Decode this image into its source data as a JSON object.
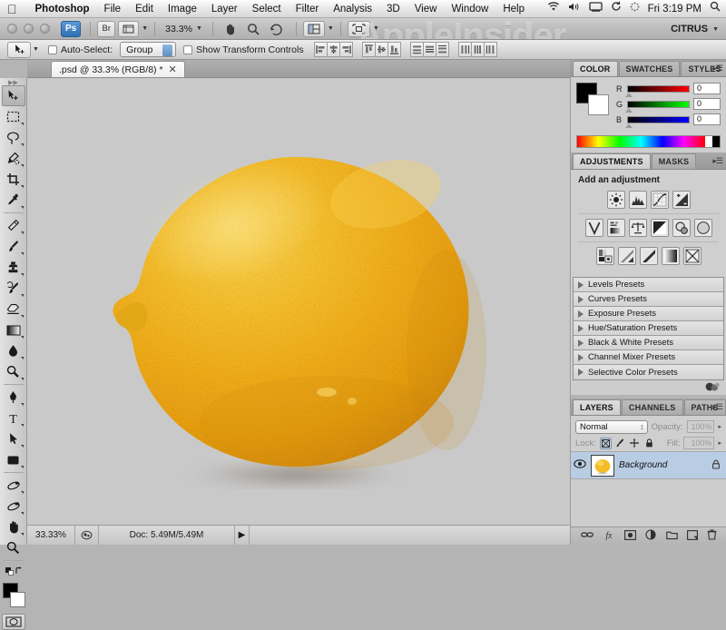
{
  "menubar": {
    "apple_icon": "apple-logo",
    "items": [
      "Photoshop",
      "File",
      "Edit",
      "Image",
      "Layer",
      "Select",
      "Filter",
      "Analysis",
      "3D",
      "View",
      "Window",
      "Help"
    ],
    "status_icons": [
      "wifi-icon",
      "volume-icon",
      "display-icon",
      "sync-icon",
      "bluetooth-icon"
    ],
    "clock": "Fri 3:19 PM",
    "search_icon": "spotlight-search-icon"
  },
  "appbar": {
    "ps_label": "Ps",
    "bridge_label": "Br",
    "view_extras_icon": "view-extras-icon",
    "zoom_level": "33.3%",
    "hand_icon": "hand-tool-icon",
    "zoom_icon": "zoom-tool-icon",
    "rotate_icon": "rotate-view-icon",
    "arrange_icon": "arrange-documents-icon",
    "screenmode_icon": "screen-mode-icon",
    "watermark": "AppleInsider",
    "workspace": "CITRUS"
  },
  "optionsbar": {
    "tool_icon": "move-tool-icon",
    "auto_select_label": "Auto-Select:",
    "auto_select_value": "Group",
    "show_transform_label": "Show Transform Controls",
    "align_groups": [
      [
        "align-left-edges",
        "align-horizontal-centers",
        "align-right-edges"
      ],
      [
        "align-top-edges",
        "align-vertical-centers",
        "align-bottom-edges"
      ],
      [
        "distribute-top-edges",
        "distribute-vertical-centers",
        "distribute-bottom-edges"
      ],
      [
        "distribute-left-edges",
        "distribute-horizontal-centers",
        "distribute-right-edges"
      ]
    ]
  },
  "document": {
    "tab_title": ".psd @ 33.3% (RGB/8) *",
    "close_icon": "close-tab-icon",
    "canvas_bg": "#c9c9c9"
  },
  "tools": {
    "top": [
      {
        "name": "move-tool",
        "glyph": "move",
        "active": true,
        "has_flyout": false
      },
      {
        "name": "marquee-tool",
        "glyph": "marquee",
        "active": false,
        "has_flyout": true
      },
      {
        "name": "lasso-tool",
        "glyph": "lasso",
        "active": false,
        "has_flyout": true
      },
      {
        "name": "quick-selection-tool",
        "glyph": "quickselect",
        "active": false,
        "has_flyout": true
      },
      {
        "name": "crop-tool",
        "glyph": "crop",
        "active": false,
        "has_flyout": true
      },
      {
        "name": "eyedropper-tool",
        "glyph": "eyedropper",
        "active": false,
        "has_flyout": true
      }
    ],
    "mid": [
      {
        "name": "spot-healing-brush-tool",
        "glyph": "healing",
        "active": false,
        "has_flyout": true
      },
      {
        "name": "brush-tool",
        "glyph": "brush",
        "active": false,
        "has_flyout": true
      },
      {
        "name": "clone-stamp-tool",
        "glyph": "stamp",
        "active": false,
        "has_flyout": true
      },
      {
        "name": "history-brush-tool",
        "glyph": "historybrush",
        "active": false,
        "has_flyout": true
      },
      {
        "name": "eraser-tool",
        "glyph": "eraser",
        "active": false,
        "has_flyout": true
      },
      {
        "name": "gradient-tool",
        "glyph": "gradient",
        "active": false,
        "has_flyout": true
      },
      {
        "name": "blur-tool",
        "glyph": "blur",
        "active": false,
        "has_flyout": true
      },
      {
        "name": "dodge-tool",
        "glyph": "dodge",
        "active": false,
        "has_flyout": true
      }
    ],
    "vector": [
      {
        "name": "pen-tool",
        "glyph": "pen",
        "active": false,
        "has_flyout": true
      },
      {
        "name": "type-tool",
        "glyph": "type",
        "active": false,
        "has_flyout": true
      },
      {
        "name": "path-selection-tool",
        "glyph": "pathselect",
        "active": false,
        "has_flyout": true
      },
      {
        "name": "rectangle-shape-tool",
        "glyph": "shape",
        "active": false,
        "has_flyout": true
      }
    ],
    "nav": [
      {
        "name": "3d-rotate-tool",
        "glyph": "rotate3d",
        "active": false,
        "has_flyout": true
      },
      {
        "name": "3d-orbit-camera-tool",
        "glyph": "orbit3d",
        "active": false,
        "has_flyout": true
      },
      {
        "name": "hand-tool",
        "glyph": "hand",
        "active": false,
        "has_flyout": true
      },
      {
        "name": "zoom-tool",
        "glyph": "zoom",
        "active": false,
        "has_flyout": false
      }
    ],
    "foreground_color": "#000000",
    "background_color": "#ffffff",
    "quick_mask_icon": "quick-mask-mode-icon"
  },
  "statusbar": {
    "zoom": "33.33%",
    "preview_icon": "preview-icon",
    "doc_info": "Doc: 5.49M/5.49M",
    "arrow_icon": "status-menu-arrow"
  },
  "color_panel": {
    "tabs": [
      {
        "label": "COLOR",
        "active": true
      },
      {
        "label": "SWATCHES",
        "active": false
      },
      {
        "label": "STYLES",
        "active": false
      }
    ],
    "menu_icon": "panel-menu-icon",
    "foreground": "#000000",
    "background": "#ffffff",
    "channels": [
      {
        "label": "R",
        "value": "0",
        "track": "linear-gradient(to right,#000000,#ff0000)"
      },
      {
        "label": "G",
        "value": "0",
        "track": "linear-gradient(to right,#000000,#00ff00)"
      },
      {
        "label": "B",
        "value": "0",
        "track": "linear-gradient(to right,#000000,#0000ff)"
      }
    ]
  },
  "adjustments_panel": {
    "tabs": [
      {
        "label": "ADJUSTMENTS",
        "active": true
      },
      {
        "label": "MASKS",
        "active": false
      }
    ],
    "menu_icon": "panel-menu-icon",
    "title": "Add an adjustment",
    "row1": [
      "brightness-contrast-icon",
      "levels-icon",
      "curves-icon",
      "exposure-icon"
    ],
    "row2": [
      "vibrance-icon",
      "hue-saturation-icon",
      "color-balance-icon",
      "black-white-icon",
      "photo-filter-icon",
      "channel-mixer-icon"
    ],
    "row3": [
      "invert-icon",
      "posterize-icon",
      "threshold-icon",
      "gradient-map-icon",
      "selective-color-icon"
    ],
    "presets": [
      "Levels Presets",
      "Curves Presets",
      "Exposure Presets",
      "Hue/Saturation Presets",
      "Black & White Presets",
      "Channel Mixer Presets",
      "Selective Color Presets"
    ],
    "footer_icon": "adjustments-footer-icon"
  },
  "layers_panel": {
    "tabs": [
      {
        "label": "LAYERS",
        "active": true
      },
      {
        "label": "CHANNELS",
        "active": false
      },
      {
        "label": "PATHS",
        "active": false
      }
    ],
    "menu_icon": "panel-menu-icon",
    "blend_mode": "Normal",
    "opacity_label": "Opacity:",
    "opacity_value": "100%",
    "lock_label": "Lock:",
    "lock_buttons": [
      "lock-transparent-pixels-icon",
      "lock-image-pixels-icon",
      "lock-position-icon",
      "lock-all-icon"
    ],
    "fill_label": "Fill:",
    "fill_value": "100%",
    "layers": [
      {
        "name": "Background",
        "visible": true,
        "locked": true,
        "thumbnail": "lemon-thumbnail",
        "selected": true
      }
    ],
    "footer_icons": [
      "link-layers-icon",
      "layer-style-fx-icon",
      "add-layer-mask-icon",
      "new-adjustment-layer-icon",
      "new-group-icon",
      "new-layer-icon",
      "delete-layer-icon"
    ]
  }
}
